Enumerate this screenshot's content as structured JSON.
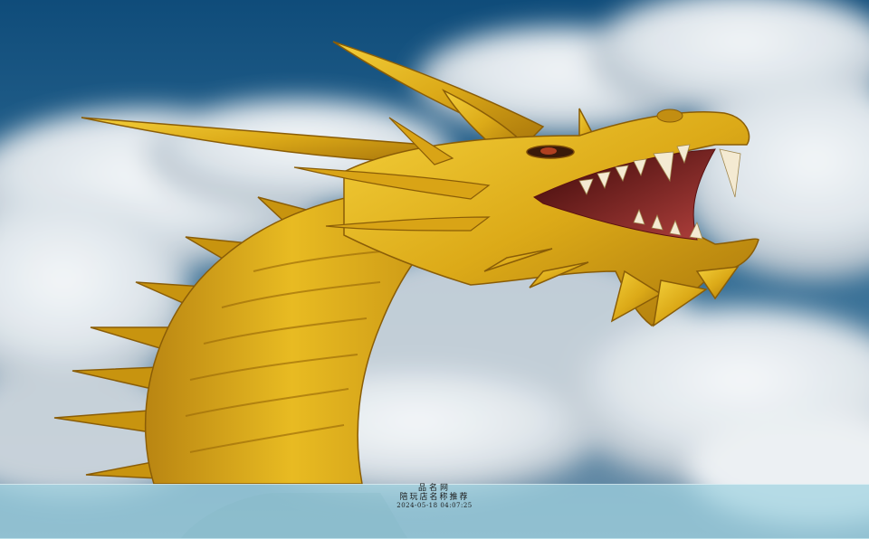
{
  "scene": {
    "subject": "golden-dragon-head",
    "colors": {
      "sky_top": "#0f4c7a",
      "sky_mid": "#2e6a93",
      "cloud": "#e9eef2",
      "cloud_shadow": "#aab7c2",
      "dragon_gold": "#e0b21c",
      "dragon_dark": "#9a6a08",
      "mouth": "#7a1a1a",
      "tooth": "#f4ead2",
      "caption_bar": "#a0d2e1"
    }
  },
  "caption": {
    "site": "品名网",
    "line": "陪玩店名称推荐",
    "timestamp": "2024-05-18 04:07:25"
  }
}
